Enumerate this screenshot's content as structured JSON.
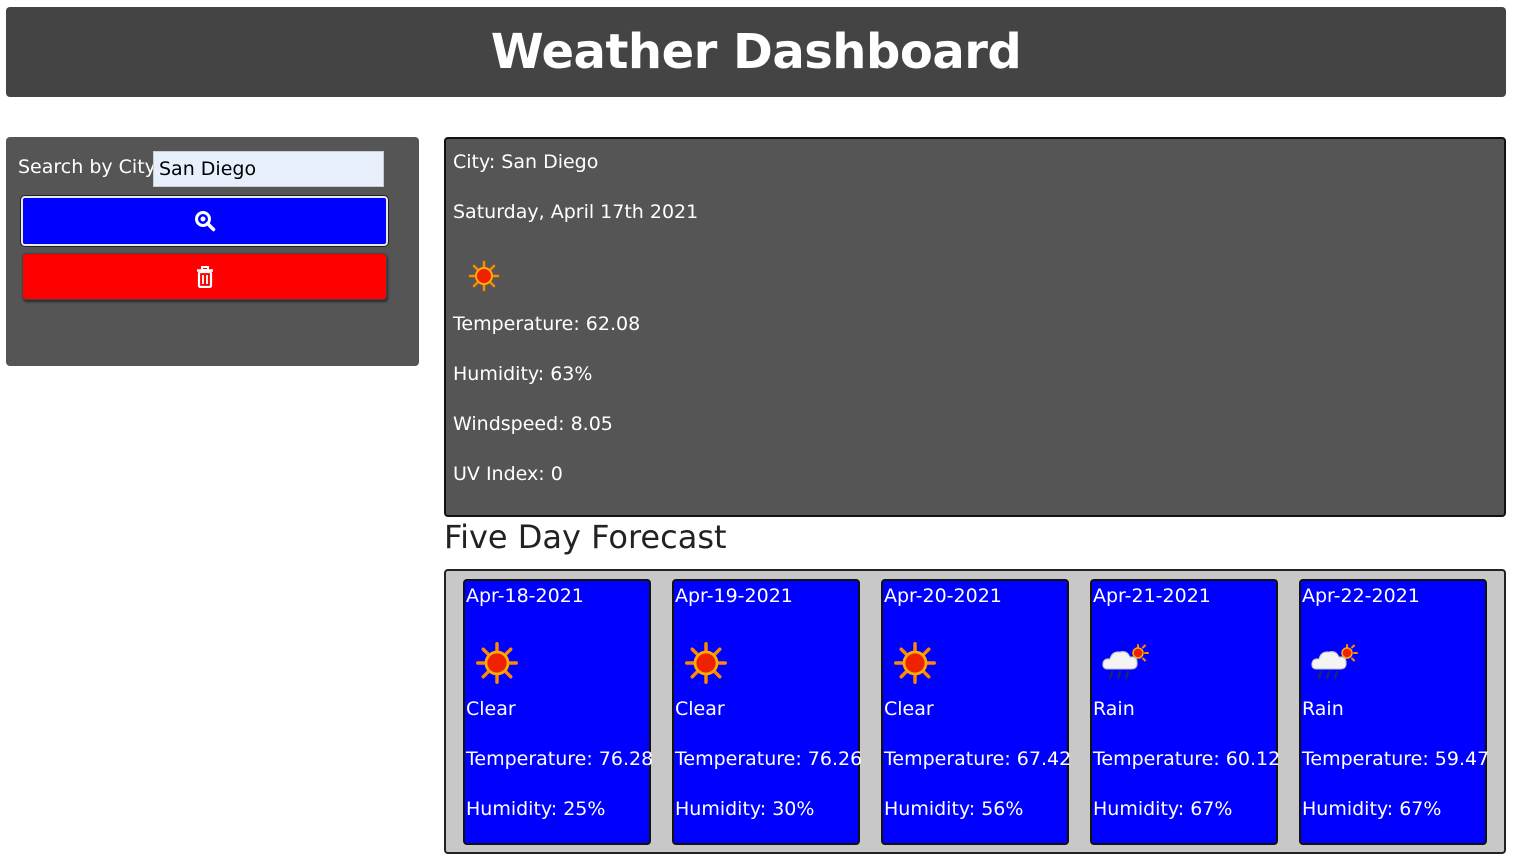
{
  "header": {
    "title": "Weather Dashboard"
  },
  "search": {
    "label": "Search by City:",
    "value": "San Diego",
    "search_button_icon": "search-icon",
    "clear_button_icon": "trash-icon"
  },
  "current": {
    "city": "City: San Diego",
    "date": "Saturday, April 17th 2021",
    "icon": "sun-icon",
    "temperature": "Temperature: 62.08",
    "humidity": "Humidity: 63%",
    "windspeed": "Windspeed: 8.05",
    "uv_index": "UV Index: 0"
  },
  "forecast": {
    "title": "Five Day Forecast",
    "days": [
      {
        "date": "Apr-18-2021",
        "icon": "sun-icon",
        "condition": "Clear",
        "temperature": "Temperature: 76.28",
        "humidity": "Humidity: 25%"
      },
      {
        "date": "Apr-19-2021",
        "icon": "sun-icon",
        "condition": "Clear",
        "temperature": "Temperature: 76.26",
        "humidity": "Humidity: 30%"
      },
      {
        "date": "Apr-20-2021",
        "icon": "sun-icon",
        "condition": "Clear",
        "temperature": "Temperature: 67.42",
        "humidity": "Humidity: 56%"
      },
      {
        "date": "Apr-21-2021",
        "icon": "rain-cloud-icon",
        "condition": "Rain",
        "temperature": "Temperature: 60.12",
        "humidity": "Humidity: 67%"
      },
      {
        "date": "Apr-22-2021",
        "icon": "rain-cloud-icon",
        "condition": "Rain",
        "temperature": "Temperature: 59.47",
        "humidity": "Humidity: 67%"
      }
    ]
  },
  "colors": {
    "header_bg": "#444444",
    "panel_bg": "#555555",
    "search_button": "#0000ff",
    "clear_button": "#ff0000",
    "card_bg": "#0000ff",
    "forecast_panel_bg": "#c8c8c8"
  }
}
